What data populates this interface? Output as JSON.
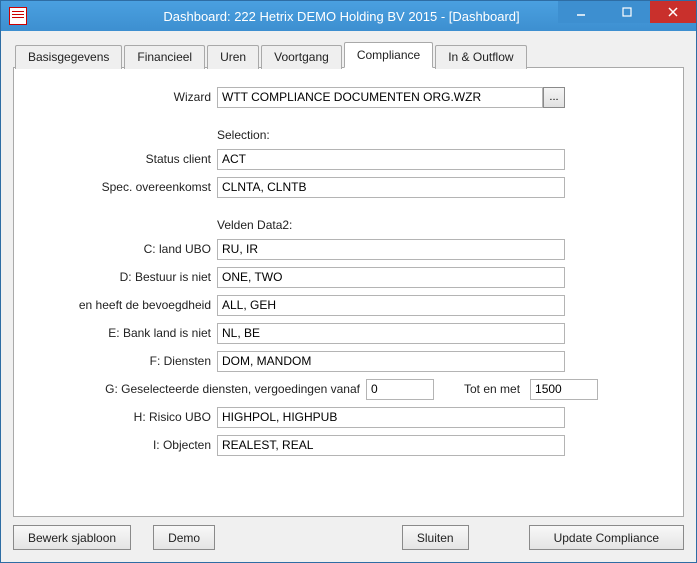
{
  "window": {
    "title": "Dashboard: 222 Hetrix DEMO Holding BV 2015 - [Dashboard]"
  },
  "tabs": [
    {
      "label": "Basisgegevens"
    },
    {
      "label": "Financieel"
    },
    {
      "label": "Uren"
    },
    {
      "label": "Voortgang"
    },
    {
      "label": "Compliance"
    },
    {
      "label": "In & Outflow"
    }
  ],
  "form": {
    "wizard_label": "Wizard",
    "wizard_value": "WTT COMPLIANCE DOCUMENTEN ORG.WZR",
    "ellipsis": "...",
    "section_selection": "Selection:",
    "status_client_label": "Status client",
    "status_client_value": "ACT",
    "spec_label": "Spec. overeenkomst",
    "spec_value": "CLNTA, CLNTB",
    "section_velden": "Velden Data2:",
    "c_label": "C: land UBO",
    "c_value": "RU, IR",
    "d_label": "D: Bestuur is niet",
    "d_value": "ONE, TWO",
    "d2_label": "en heeft de bevoegdheid",
    "d2_value": "ALL, GEH",
    "e_label": "E: Bank land is niet",
    "e_value": "NL, BE",
    "f_label": "F: Diensten",
    "f_value": "DOM, MANDOM",
    "g_label": "G: Geselecteerde diensten, vergoedingen vanaf",
    "g_from": "0",
    "g_to_label": "Tot en met",
    "g_to": "1500",
    "h_label": "H: Risico UBO",
    "h_value": "HIGHPOL, HIGHPUB",
    "i_label": "I: Objecten",
    "i_value": "REALEST, REAL"
  },
  "buttons": {
    "bewerk": "Bewerk sjabloon",
    "demo": "Demo",
    "sluiten": "Sluiten",
    "update": "Update Compliance"
  }
}
